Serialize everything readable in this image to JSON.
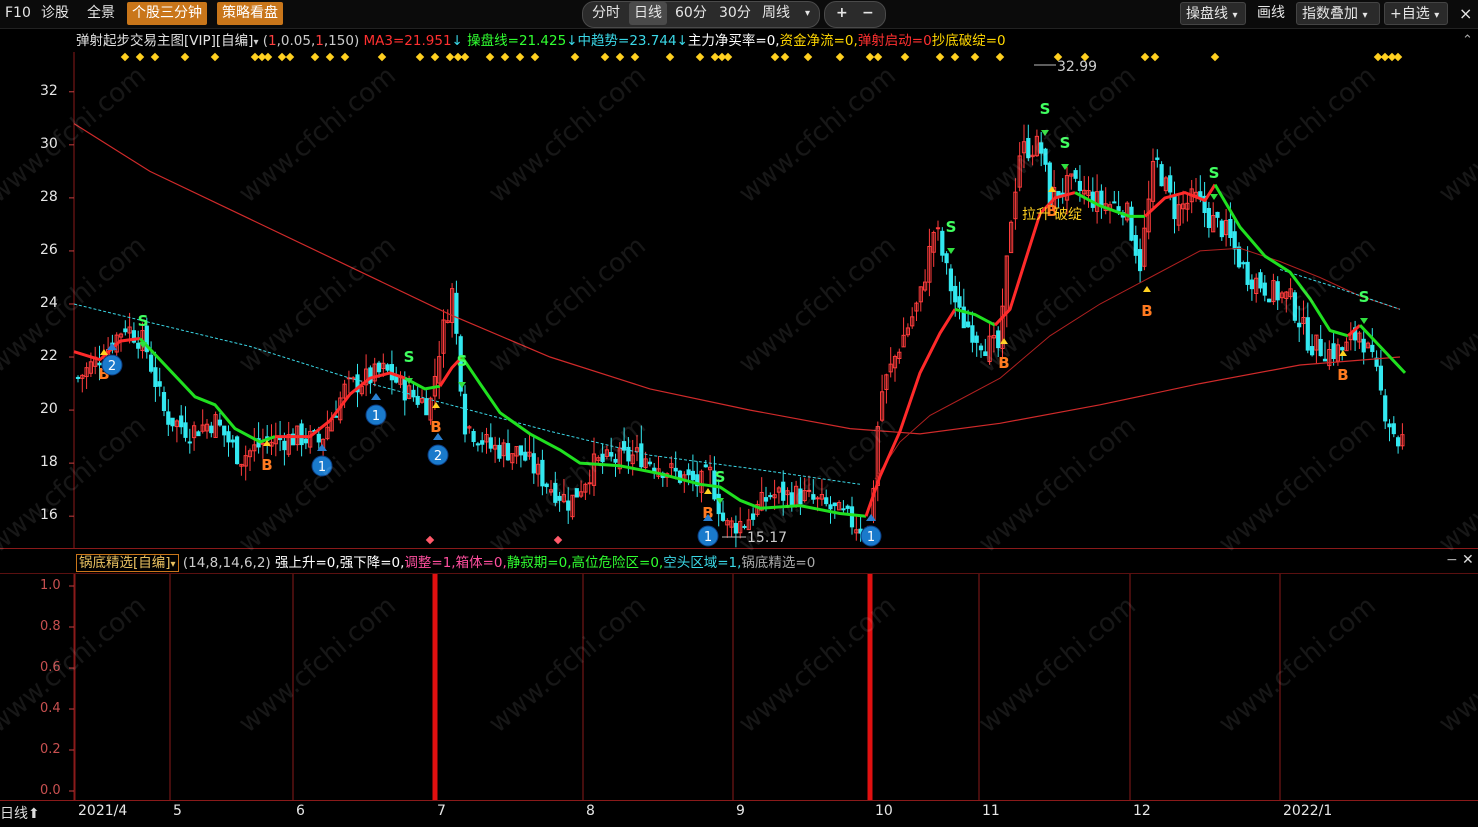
{
  "toolbar": {
    "left": [
      "F10",
      "诊股",
      "全景"
    ],
    "orange_buttons": [
      "个股三分钟",
      "策略看盘"
    ],
    "periods": [
      "分时",
      "日线",
      "60分",
      "30分",
      "周线"
    ],
    "period_active": "日线",
    "zoom_in": "+",
    "zoom_out": "−",
    "right": [
      "操盘线",
      "画线",
      "指数叠加",
      "+自选"
    ],
    "close": "×"
  },
  "main_indicator": {
    "name": "弹射起步交易主图[VIP][自编]",
    "params_open": "(",
    "p1": "1",
    "p2": ",0.05,",
    "p3": "1",
    "p4": ",150)",
    "ma3": "MA3=21.951",
    "caopan": "操盘线=21.425",
    "zhongqushi": "中趋势=23.744",
    "zhuli": "主力净买率=0,",
    "zijin": "资金净流=0,",
    "tanshe": "弹射启动=0",
    "chaodi": "抄底破绽=0"
  },
  "sub_indicator": {
    "name": "锅底精选[自编]",
    "params": "(14,8,14,6,2)",
    "qiangshang": "强上升=0,",
    "qiangxia": "强下降=0,",
    "tiaozheng": "调整=1,",
    "xiangti": "箱体=0,",
    "jingji": "静寂期=0,",
    "gaowei": "高位危险区=0,",
    "kongtou": "空头区域=1,",
    "guodi": "锅底精选=0"
  },
  "chart_data": {
    "type": "candlestick",
    "y_ticks": [
      "32",
      "30",
      "28",
      "26",
      "24",
      "22",
      "20",
      "18",
      "16"
    ],
    "ylim": [
      14.8,
      33.5
    ],
    "sub_y_ticks": [
      "1.0",
      "0.8",
      "0.6",
      "0.4",
      "0.2",
      "0.0"
    ],
    "x_ticks": [
      "2021/4",
      "5",
      "6",
      "7",
      "8",
      "9",
      "10",
      "11",
      "12",
      "2022/1"
    ],
    "annotations": {
      "high": "32.99",
      "low": "15.17",
      "label_lasheng": "拉升",
      "label_posheng": "破绽"
    },
    "markers": {
      "buy": "B",
      "sell": "S",
      "num1": "1",
      "num2": "2"
    },
    "colors": {
      "up": "#ff3c3c",
      "down": "#33e8f0",
      "thick_up": "#ff2a2a",
      "thick_down": "#20e020",
      "ma": "#d02a2a",
      "mid": "#3ad7e6"
    }
  },
  "status": {
    "period_label": "日线",
    "arrow": "⬆"
  },
  "watermark": "www.cfchi.com"
}
